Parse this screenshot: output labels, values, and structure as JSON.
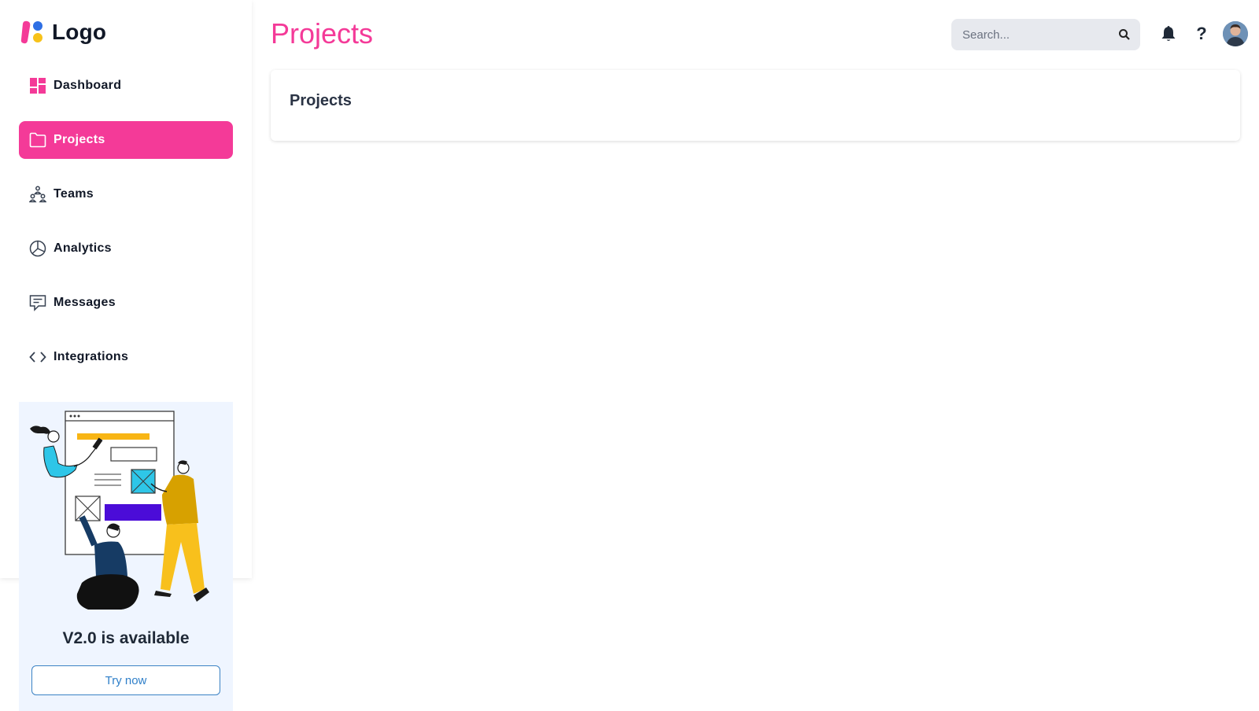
{
  "brand": {
    "logo_text": "Logo",
    "accent_color": "#f43a98"
  },
  "sidebar": {
    "items": [
      {
        "label": "Dashboard",
        "icon": "dashboard-icon",
        "active": false
      },
      {
        "label": "Projects",
        "icon": "folder-icon",
        "active": true
      },
      {
        "label": "Teams",
        "icon": "teams-icon",
        "active": false
      },
      {
        "label": "Analytics",
        "icon": "pie-chart-icon",
        "active": false
      },
      {
        "label": "Messages",
        "icon": "message-icon",
        "active": false
      },
      {
        "label": "Integrations",
        "icon": "code-icon",
        "active": false
      }
    ]
  },
  "promo": {
    "title": "V2.0 is available",
    "button_label": "Try now"
  },
  "header": {
    "title": "Projects",
    "search_placeholder": "Search...",
    "help_label": "?"
  },
  "main": {
    "card_title": "Projects"
  }
}
